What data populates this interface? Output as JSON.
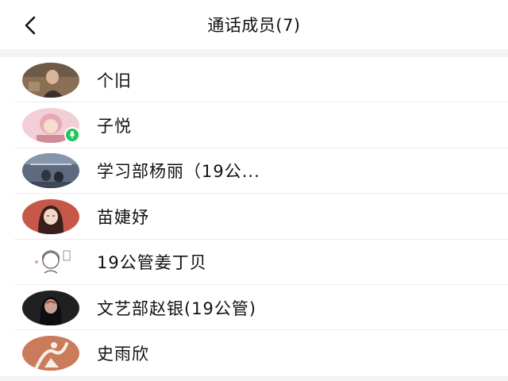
{
  "header": {
    "title": "通话成员(7)"
  },
  "members": [
    {
      "name": "个旧"
    },
    {
      "name": "子悦",
      "mic_active": true
    },
    {
      "name": "学习部杨丽（19公..."
    },
    {
      "name": "苗婕妤"
    },
    {
      "name": "19公管姜丁贝"
    },
    {
      "name": "文艺部赵银(19公管)"
    },
    {
      "name": "史雨欣"
    }
  ],
  "colors": {
    "background": "#f3f3f6",
    "mic_badge": "#22c55e"
  }
}
